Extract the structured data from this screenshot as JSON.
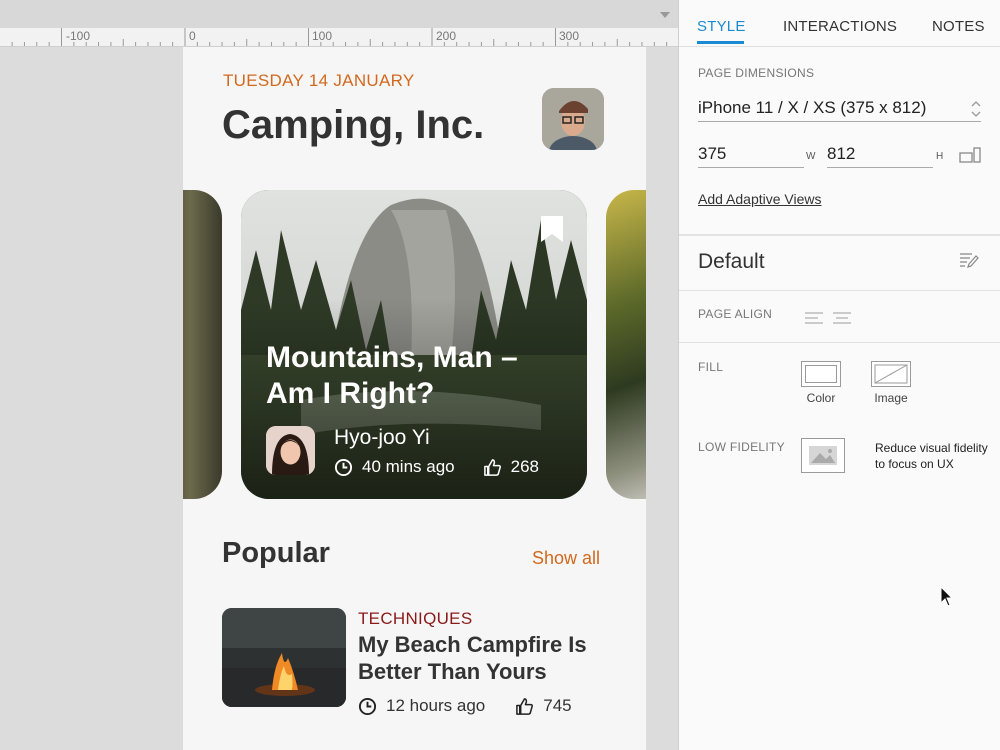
{
  "ruler": {
    "labels": [
      "-100",
      "0",
      "100",
      "200",
      "300"
    ]
  },
  "phone": {
    "date": "TUESDAY 14 JANUARY",
    "title": "Camping, Inc.",
    "featured": {
      "title": "Mountains, Man – Am I Right?",
      "author": "Hyo-joo Yi",
      "time": "40 mins ago",
      "likes": "268"
    },
    "popular": {
      "heading": "Popular",
      "show_all": "Show all",
      "item": {
        "category": "TECHNIQUES",
        "title": "My Beach Campfire Is Better Than Yours",
        "time": "12 hours ago",
        "likes": "745"
      }
    }
  },
  "panel": {
    "tabs": [
      "STYLE",
      "INTERACTIONS",
      "NOTES"
    ],
    "active_tab": "STYLE",
    "page_dimensions_label": "PAGE DIMENSIONS",
    "device": "iPhone 11 / X / XS  (375 x 812)",
    "width_value": "375",
    "width_unit": "W",
    "height_value": "812",
    "height_unit": "H",
    "adaptive_link": "Add Adaptive Views",
    "style_name": "Default",
    "page_align_label": "PAGE ALIGN",
    "fill_label": "FILL",
    "fill_color_label": "Color",
    "fill_image_label": "Image",
    "low_fidelity_label": "LOW FIDELITY",
    "low_fidelity_desc": "Reduce visual fidelity to focus on UX"
  },
  "colors": {
    "accent_orange": "#d2691e",
    "category_red": "#8b1a1a",
    "tab_active_blue": "#1a8bd2",
    "title_dark": "#333333"
  },
  "icons": [
    "bookmark-icon",
    "clock-icon",
    "thumbs-up-icon",
    "orientation-icon",
    "edit-style-icon",
    "align-left-icon",
    "align-center-icon",
    "image-placeholder-icon",
    "mouse-cursor-icon",
    "dropdown-arrow-icon"
  ]
}
